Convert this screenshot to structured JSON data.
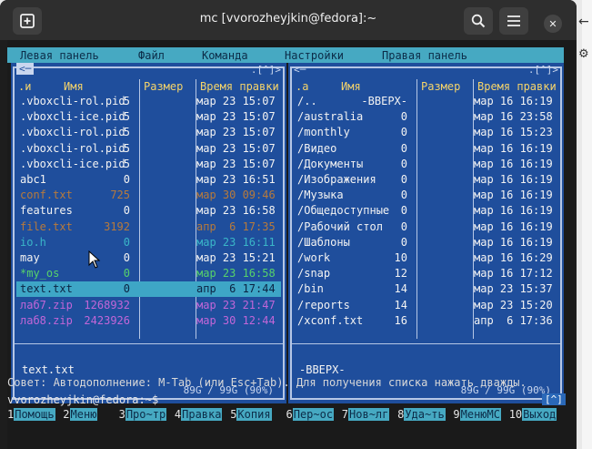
{
  "window": {
    "title": "mc [vvorozheyjkin@fedora]:~",
    "new_tab_icon": "plus-square-icon",
    "search_icon": "search-icon",
    "menu_icon": "hamburger-menu-icon",
    "close_icon": "close-icon"
  },
  "menubar": [
    "Левая панель",
    "Файл",
    "Команда",
    "Настройки",
    "Правая панель"
  ],
  "left_panel": {
    "topline_left": "<─",
    "topline_right": ".[^]>",
    "headers": {
      "n": ".и",
      "name": "Имя",
      "size": "Размер",
      "time": "Время правки"
    },
    "rows": [
      {
        "name": ".vboxcli-rol.pid",
        "size": "5",
        "time": "мар 23 15:07",
        "color": "#f3f3f3"
      },
      {
        "name": ".vboxcli-ice.pid",
        "size": "5",
        "time": "мар 23 15:07",
        "color": "#f3f3f3"
      },
      {
        "name": ".vboxcli-rol.pid",
        "size": "5",
        "time": "мар 23 15:07",
        "color": "#f3f3f3"
      },
      {
        "name": ".vboxcli-rol.pid",
        "size": "5",
        "time": "мар 23 15:07",
        "color": "#f3f3f3"
      },
      {
        "name": ".vboxcli-ice.pid",
        "size": "5",
        "time": "мар 23 15:07",
        "color": "#f3f3f3"
      },
      {
        "name": "abc1",
        "size": "0",
        "time": "мар 23 16:51",
        "color": "#f3f3f3"
      },
      {
        "name": "conf.txt",
        "size": "725",
        "time": "мар 30 09:46",
        "color": "#b77a3c"
      },
      {
        "name": "features",
        "size": "0",
        "time": "мар 23 16:58",
        "color": "#f3f3f3"
      },
      {
        "name": "file.txt",
        "size": "3192",
        "time": "апр  6 17:35",
        "color": "#b77a3c"
      },
      {
        "name": "io.h",
        "size": "0",
        "time": "мар 23 16:11",
        "color": "#3ab6c8"
      },
      {
        "name": "may",
        "size": "0",
        "time": "мар 23 15:21",
        "color": "#f3f3f3"
      },
      {
        "name": "*my_os",
        "size": "0",
        "time": "мар 23 16:58",
        "color": "#57d26a"
      },
      {
        "name": "text.txt",
        "size": "0",
        "time": "апр  6 17:44",
        "color": "#0b2342",
        "selected": true
      },
      {
        "name": "лаб7.zip",
        "size": "1268932",
        "time": "мар 23 21:47",
        "color": "#c266d8"
      },
      {
        "name": "лаб8.zip",
        "size": "2423926",
        "time": "мар 30 12:44",
        "color": "#c266d8"
      }
    ],
    "mini_info": "text.txt",
    "disk_info": "89G / 99G (90%)"
  },
  "right_panel": {
    "topline_left": "<─",
    "topline_right": ".[^]>",
    "headers": {
      "n": ".а",
      "name": "Имя",
      "size": "Размер",
      "time": "Время правки"
    },
    "rows": [
      {
        "name": "/..",
        "size": "-ВВЕРХ-",
        "time": "мар 16 16:19"
      },
      {
        "name": "/australia",
        "size": "0",
        "time": "мар 16 23:58"
      },
      {
        "name": "/monthly",
        "size": "0",
        "time": "мар 16 15:23"
      },
      {
        "name": "/Видео",
        "size": "0",
        "time": "мар 16 16:19"
      },
      {
        "name": "/Документы",
        "size": "0",
        "time": "мар 16 16:19"
      },
      {
        "name": "/Изображения",
        "size": "0",
        "time": "мар 16 16:19"
      },
      {
        "name": "/Музыка",
        "size": "0",
        "time": "мар 16 16:19"
      },
      {
        "name": "/Общедоступные",
        "size": "0",
        "time": "мар 16 16:19"
      },
      {
        "name": "/Рабочий стол",
        "size": "0",
        "time": "мар 16 16:19"
      },
      {
        "name": "/Шаблоны",
        "size": "0",
        "time": "мар 16 16:19"
      },
      {
        "name": "/work",
        "size": "10",
        "time": "мар 16 16:29"
      },
      {
        "name": "/snap",
        "size": "12",
        "time": "мар 16 17:12"
      },
      {
        "name": "/bin",
        "size": "14",
        "time": "мар 23 15:37"
      },
      {
        "name": "/reports",
        "size": "14",
        "time": "мар 23 15:20"
      },
      {
        "name": "/xconf.txt",
        "size": "16",
        "time": "апр  6 17:36"
      }
    ],
    "mini_info": "-ВВЕРХ-",
    "disk_info": "89G / 99G (90%)"
  },
  "hint": "Совет: Автодополнение: M-Tab (или Esc+Tab). Для получения списка нажать дважды.",
  "prompt": "vvorozheyjkin@fedora:~$",
  "prompt_box": "[^]",
  "fkeys": [
    {
      "num": "1",
      "label": "Помощь"
    },
    {
      "num": "2",
      "label": "Меню"
    },
    {
      "num": "3",
      "label": "Про~тр"
    },
    {
      "num": "4",
      "label": "Правка"
    },
    {
      "num": "5",
      "label": "Копия"
    },
    {
      "num": "6",
      "label": "Пер~ос"
    },
    {
      "num": "7",
      "label": "Нов~лг"
    },
    {
      "num": "8",
      "label": "Уда~ть"
    },
    {
      "num": "9",
      "label": "МенюМС"
    },
    {
      "num": "10",
      "label": "Выход"
    }
  ],
  "side": {
    "back_icon": "arrow-left-icon",
    "settings_icon": "gear-icon"
  }
}
